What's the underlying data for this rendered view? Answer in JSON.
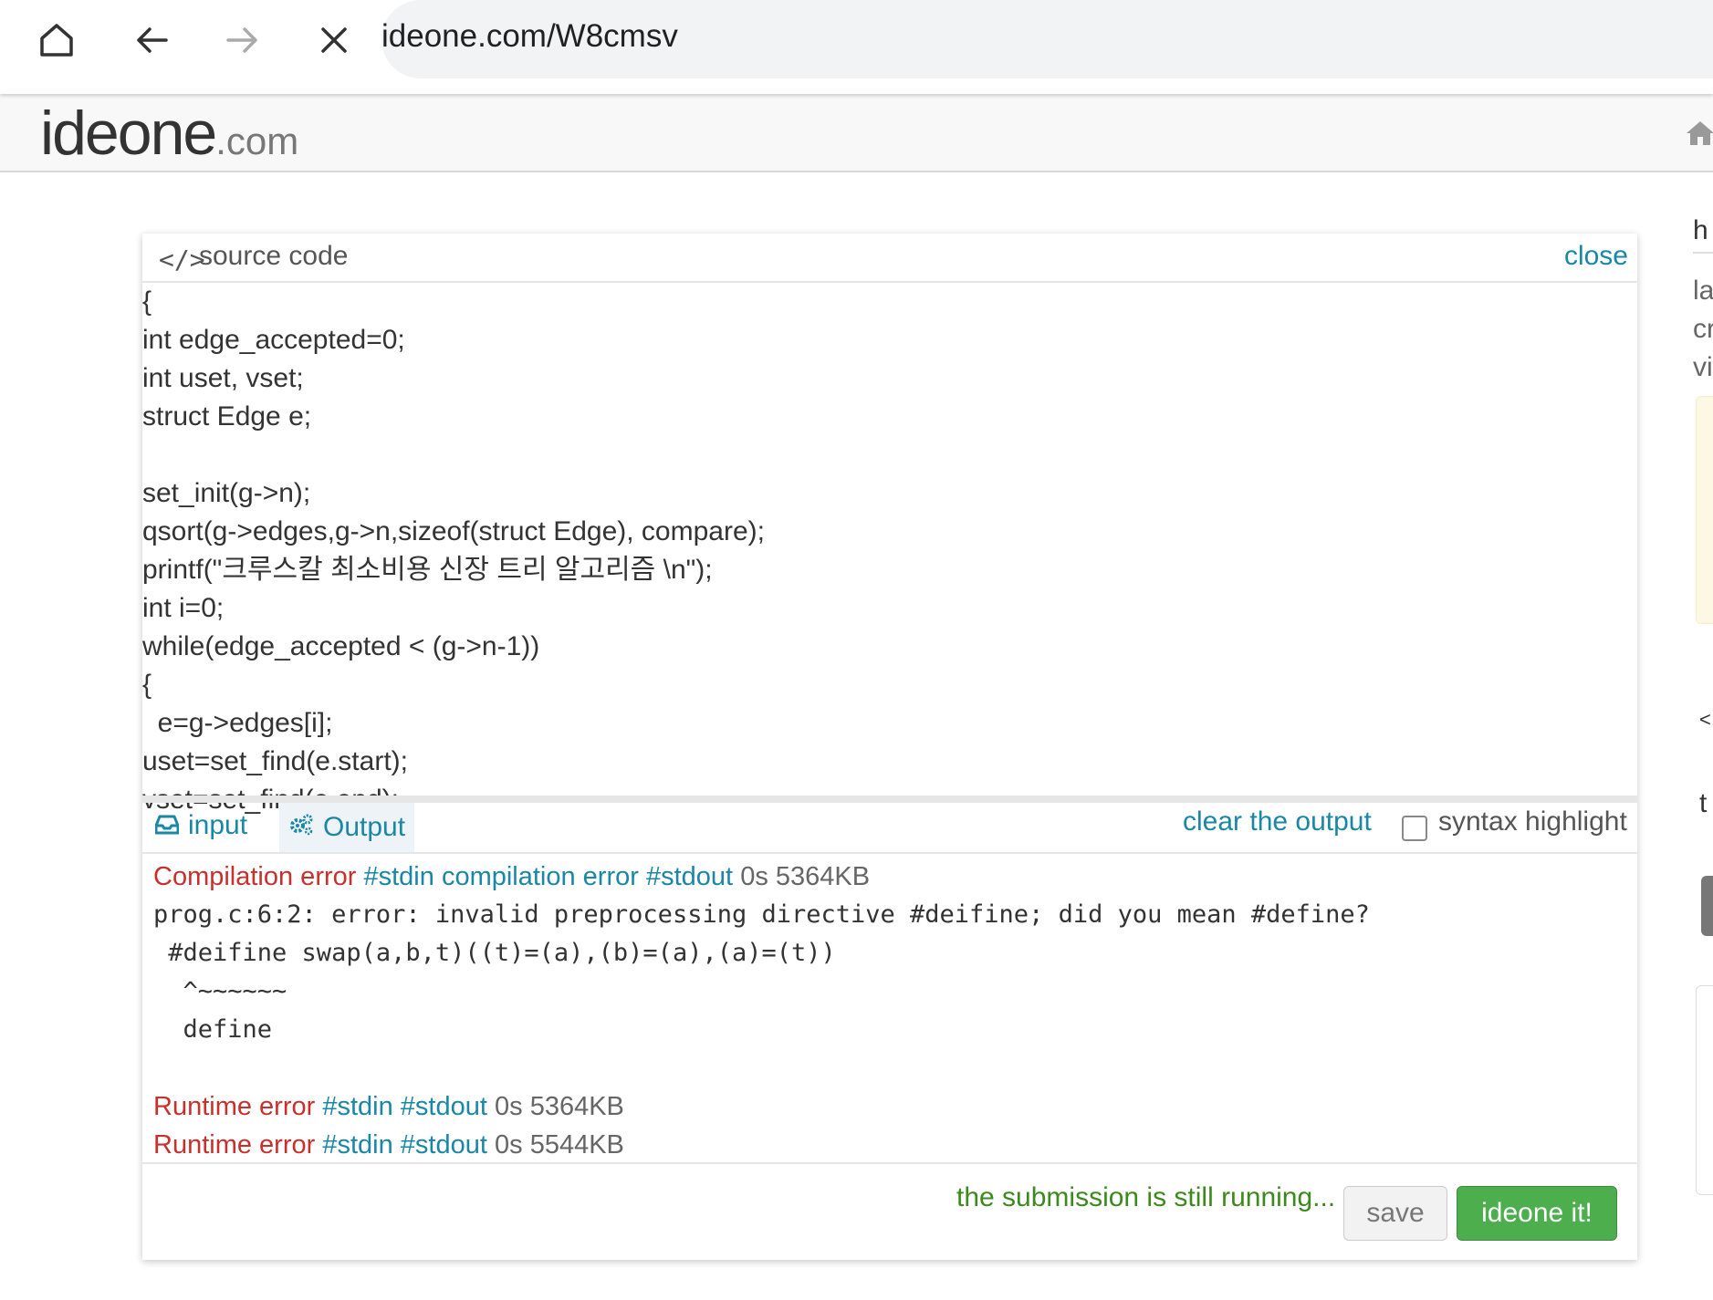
{
  "browser": {
    "url": "ideone.com/W8cmsv"
  },
  "site": {
    "logo_main": "ideone",
    "logo_tld": ".com"
  },
  "sidebar_fragments": [
    "h",
    "la",
    "cr",
    "vi",
    "<",
    "t"
  ],
  "panel": {
    "title": "source code",
    "close_label": "close",
    "code_lines": [
      "{",
      "int edge_accepted=0;",
      "int uset, vset;",
      "struct Edge e;",
      "",
      "set_init(g->n);",
      "qsort(g->edges,g->n,sizeof(struct Edge), compare);",
      "printf(\"크루스칼 최소비용 신장 트리 알고리즘 \\n\");",
      "int i=0;",
      "while(edge_accepted < (g->n-1))",
      "{",
      "  e=g->edges[i];",
      "uset=set_find(e.start);",
      "vset=set_find(e.end);"
    ]
  },
  "io": {
    "input_tab": "input",
    "output_tab": "Output",
    "clear_label": "clear the output",
    "syntax_label": "syntax highlight",
    "syntax_checked": false
  },
  "results": {
    "first": {
      "status": "Compilation error",
      "stdin": "#stdin",
      "extra": "compilation error",
      "stdout": "#stdout",
      "time": "0s",
      "memory": "5364KB"
    },
    "compiler_output": [
      "prog.c:6:2: error: invalid preprocessing directive #deifine; did you mean #define?",
      " #deifine swap(a,b,t)((t)=(a),(b)=(a),(a)=(t))",
      "  ^~~~~~~",
      "  define"
    ],
    "second": {
      "status": "Runtime error",
      "stdin": "#stdin",
      "stdout": "#stdout",
      "time": "0s",
      "memory": "5364KB"
    },
    "third": {
      "status": "Runtime error",
      "stdin": "#stdin",
      "stdout": "#stdout",
      "time": "0s",
      "memory": "5544KB"
    }
  },
  "footer": {
    "running_message": "the submission is still running...",
    "save_label": "save",
    "run_label": "ideone it!"
  },
  "colors": {
    "link": "#1a87a6",
    "error": "#c9302c",
    "success": "#4cae4c",
    "running": "#3c8a1e"
  }
}
